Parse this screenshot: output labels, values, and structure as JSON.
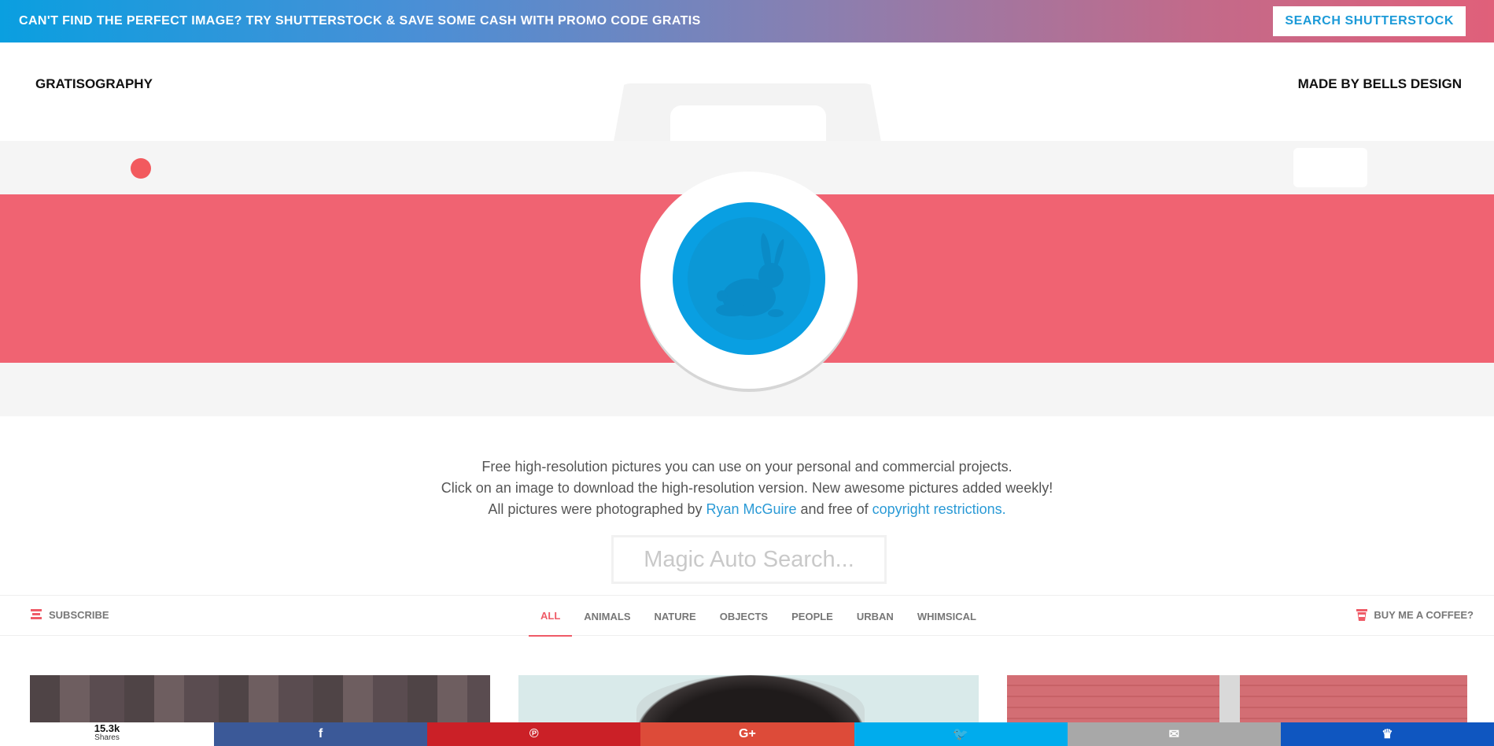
{
  "promo": {
    "text": "CAN'T FIND THE PERFECT IMAGE? TRY SHUTTERSTOCK & SAVE SOME CASH WITH PROMO CODE GRATIS",
    "button_label": "SEARCH SHUTTERSTOCK"
  },
  "header": {
    "brand": "GRATISOGRAPHY",
    "maker": "MADE BY BELLS DESIGN"
  },
  "intro": {
    "line1": "Free high-resolution pictures you can use on your personal and commercial projects.",
    "line2": "Click on an image to download the high-resolution version. New awesome pictures added weekly!",
    "line3_prefix": "All pictures were photographed by",
    "photographer_link": "Ryan McGuire",
    "line3_middle": "and free of",
    "copyright_link": "copyright restrictions."
  },
  "search": {
    "placeholder": "Magic Auto Search..."
  },
  "nav": {
    "subscribe_label": "SUBSCRIBE",
    "coffee_label": "BUY ME A COFFEE?",
    "tabs": [
      {
        "label": "ALL",
        "active": true
      },
      {
        "label": "ANIMALS",
        "active": false
      },
      {
        "label": "NATURE",
        "active": false
      },
      {
        "label": "OBJECTS",
        "active": false
      },
      {
        "label": "PEOPLE",
        "active": false
      },
      {
        "label": "URBAN",
        "active": false
      },
      {
        "label": "WHIMSICAL",
        "active": false
      }
    ]
  },
  "share": {
    "count": "15.3k",
    "count_label": "Shares",
    "buttons": [
      {
        "name": "facebook",
        "glyph": "f",
        "color": "#3b5998"
      },
      {
        "name": "pinterest",
        "glyph": "℗",
        "color": "#cb2027"
      },
      {
        "name": "google-plus",
        "glyph": "G+",
        "color": "#dd4b39"
      },
      {
        "name": "twitter",
        "glyph": "🐦",
        "color": "#00aced"
      },
      {
        "name": "email",
        "glyph": "✉",
        "color": "#a8a8a8"
      },
      {
        "name": "sumo",
        "glyph": "♛",
        "color": "#0f56c0"
      }
    ]
  },
  "colors": {
    "accent_red": "#f06372",
    "lens_blue": "#099fe2",
    "link_blue": "#2a9ad6"
  }
}
